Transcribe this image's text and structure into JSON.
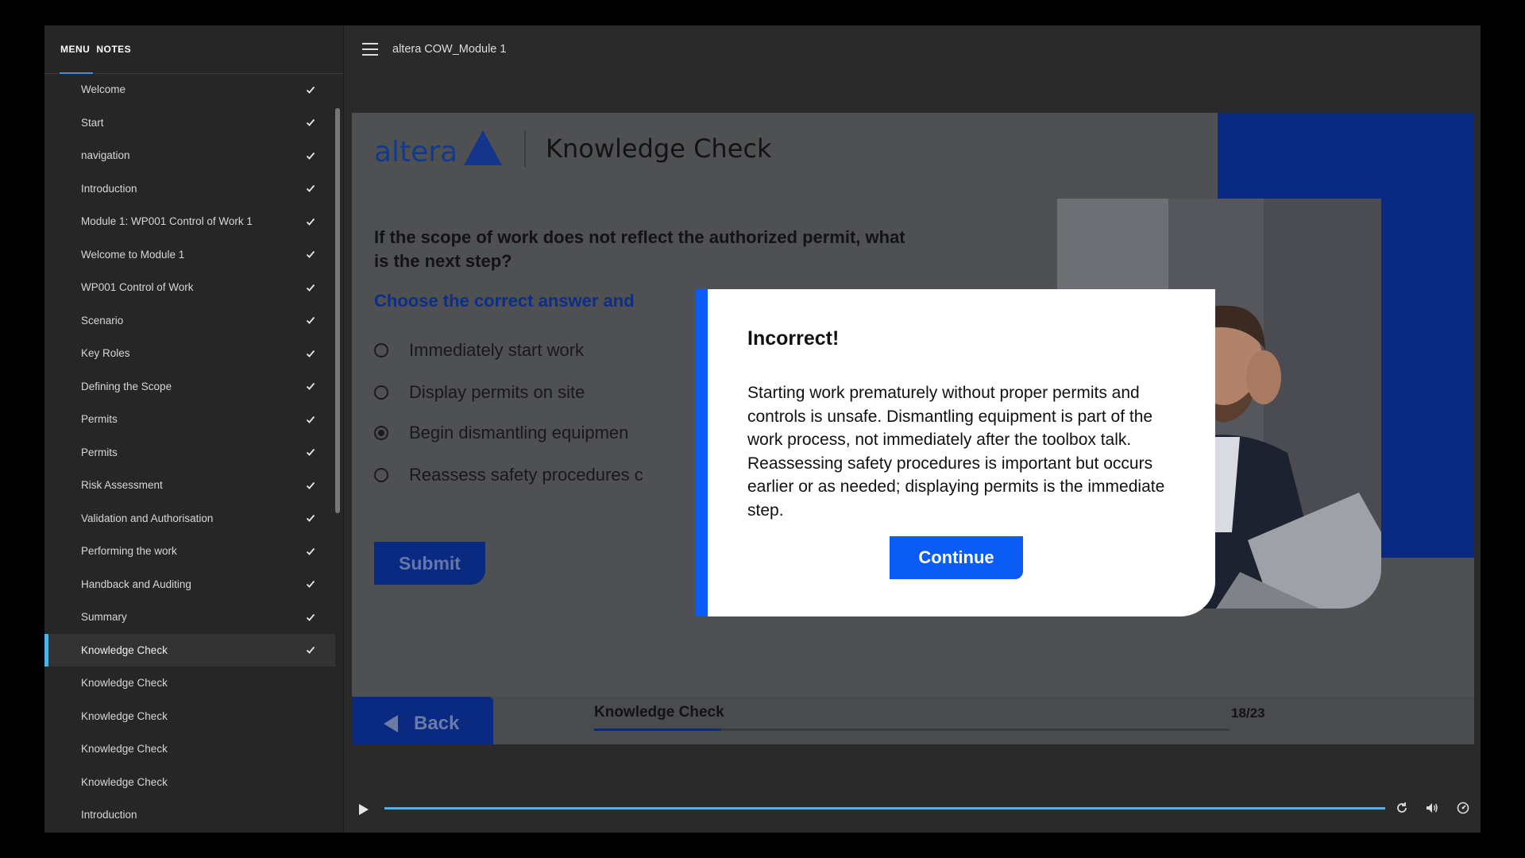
{
  "sidebar": {
    "tabs": [
      {
        "label": "MENU"
      },
      {
        "label": "NOTES"
      }
    ],
    "items": [
      {
        "label": "Welcome",
        "checked": true
      },
      {
        "label": "Start",
        "checked": true
      },
      {
        "label": "navigation",
        "checked": true
      },
      {
        "label": "Introduction",
        "checked": true
      },
      {
        "label": "Module 1: WP001 Control of Work 1",
        "checked": true
      },
      {
        "label": "Welcome to Module 1",
        "checked": true
      },
      {
        "label": "WP001 Control of Work",
        "checked": true
      },
      {
        "label": "Scenario",
        "checked": true
      },
      {
        "label": "Key Roles",
        "checked": true
      },
      {
        "label": "Defining the Scope",
        "checked": true
      },
      {
        "label": "Permits",
        "checked": true
      },
      {
        "label": "Permits",
        "checked": true
      },
      {
        "label": "Risk Assessment",
        "checked": true
      },
      {
        "label": "Validation and Authorisation",
        "checked": true
      },
      {
        "label": "Performing the work",
        "checked": true
      },
      {
        "label": "Handback and Auditing",
        "checked": true
      },
      {
        "label": "Summary",
        "checked": true
      },
      {
        "label": "Knowledge Check",
        "checked": true,
        "active": true
      },
      {
        "label": "Knowledge Check",
        "checked": false
      },
      {
        "label": "Knowledge Check",
        "checked": false
      },
      {
        "label": "Knowledge Check",
        "checked": false
      },
      {
        "label": "Knowledge Check",
        "checked": false
      },
      {
        "label": "Introduction",
        "checked": false
      }
    ]
  },
  "topbar": {
    "course_title": "altera COW_Module 1"
  },
  "slide": {
    "logo_text": "altera",
    "title": "Knowledge Check",
    "question": "If the scope of work does not reflect the authorized permit, what is the next step?",
    "instruction": "Choose the correct answer and",
    "options": [
      {
        "label": "Immediately start work",
        "selected": false
      },
      {
        "label": "Display permits on site",
        "selected": false
      },
      {
        "label": "Begin dismantling equipmen",
        "selected": true
      },
      {
        "label": "Reassess safety procedures c",
        "selected": false
      }
    ],
    "submit_label": "Submit",
    "back_label": "Back",
    "footer_title": "Knowledge Check",
    "counter": "18/23",
    "progress": 0.2
  },
  "modal": {
    "title": "Incorrect!",
    "body": "Starting work prematurely without proper permits and controls is unsafe. Dismantling equipment is part of the work process, not immediately after the toolbox talk. Reassessing safety procedures is important but occurs earlier or as needed; displaying permits is the immediate step.",
    "continue_label": "Continue"
  },
  "playbar": {
    "progress": 1.0,
    "icons": [
      "replay-icon",
      "volume-icon",
      "speed-icon"
    ]
  },
  "colors": {
    "brand_blue": "#0a2a82",
    "modal_blue": "#0a5cf5",
    "active_accent": "#4fb3e8"
  }
}
